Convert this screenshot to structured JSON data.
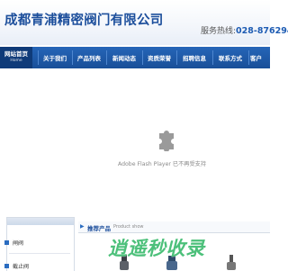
{
  "header": {
    "company_name": "成都青浦精密阀门有限公司",
    "hotline_label": "服务热线:",
    "hotline_number": "028-876294"
  },
  "nav": {
    "items": [
      {
        "label": "网站首页",
        "sub": "Home",
        "active": true
      },
      {
        "label": "关于我们"
      },
      {
        "label": "产品列表"
      },
      {
        "label": "新闻动态"
      },
      {
        "label": "资质荣誉"
      },
      {
        "label": "招聘信息"
      },
      {
        "label": "联系方式"
      },
      {
        "label": "客户"
      }
    ]
  },
  "banner": {
    "plugin_message": "Adobe Flash Player 已不再受支持",
    "icon": "puzzle-plugin-icon"
  },
  "sidebar": {
    "categories": [
      {
        "label": "闸阀"
      },
      {
        "label": "截止阀"
      }
    ]
  },
  "products": {
    "title": "推荐产品",
    "subtitle": "Product show"
  },
  "watermark": {
    "text": "逍遥秒收录"
  },
  "colors": {
    "brand_blue": "#1d4f9c",
    "nav_blue": "#194f98",
    "watermark_green": "#4cc07a"
  }
}
